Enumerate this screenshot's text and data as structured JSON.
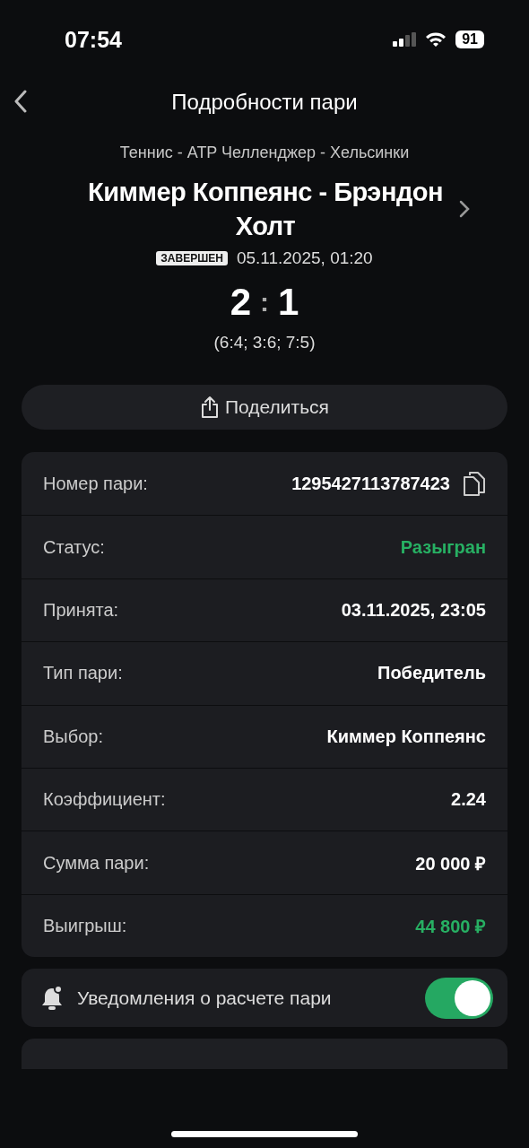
{
  "status_bar": {
    "time": "07:54",
    "battery": "91"
  },
  "nav": {
    "title": "Подробности пари"
  },
  "event": {
    "league": "Теннис - ATP Челленджер - Хельсинки",
    "match": "Киммер Коппеянс - Брэндон Холт",
    "status_badge": "ЗАВЕРШЕН",
    "datetime": "05.11.2025, 01:20",
    "score_home": "2",
    "score_sep": ":",
    "score_away": "1",
    "sets": "(6:4; 3:6; 7:5)"
  },
  "share_button": "Поделиться",
  "details": [
    {
      "label": "Номер пари:",
      "value": "1295427113787423",
      "kind": "copy"
    },
    {
      "label": "Статус:",
      "value": "Разыгран",
      "kind": "positive"
    },
    {
      "label": "Принята:",
      "value": "03.11.2025, 23:05",
      "kind": "plain"
    },
    {
      "label": "Тип пари:",
      "value": "Победитель",
      "kind": "plain"
    },
    {
      "label": "Выбор:",
      "value": "Киммер Коппеянс",
      "kind": "plain"
    },
    {
      "label": "Коэффициент:",
      "value": "2.24",
      "kind": "plain"
    },
    {
      "label": "Сумма пари:",
      "value": "20 000 ₽",
      "kind": "plain"
    },
    {
      "label": "Выигрыш:",
      "value": "44 800 ₽",
      "kind": "positive"
    }
  ],
  "notifications": {
    "label": "Уведомления о расчете пари",
    "on": true
  }
}
